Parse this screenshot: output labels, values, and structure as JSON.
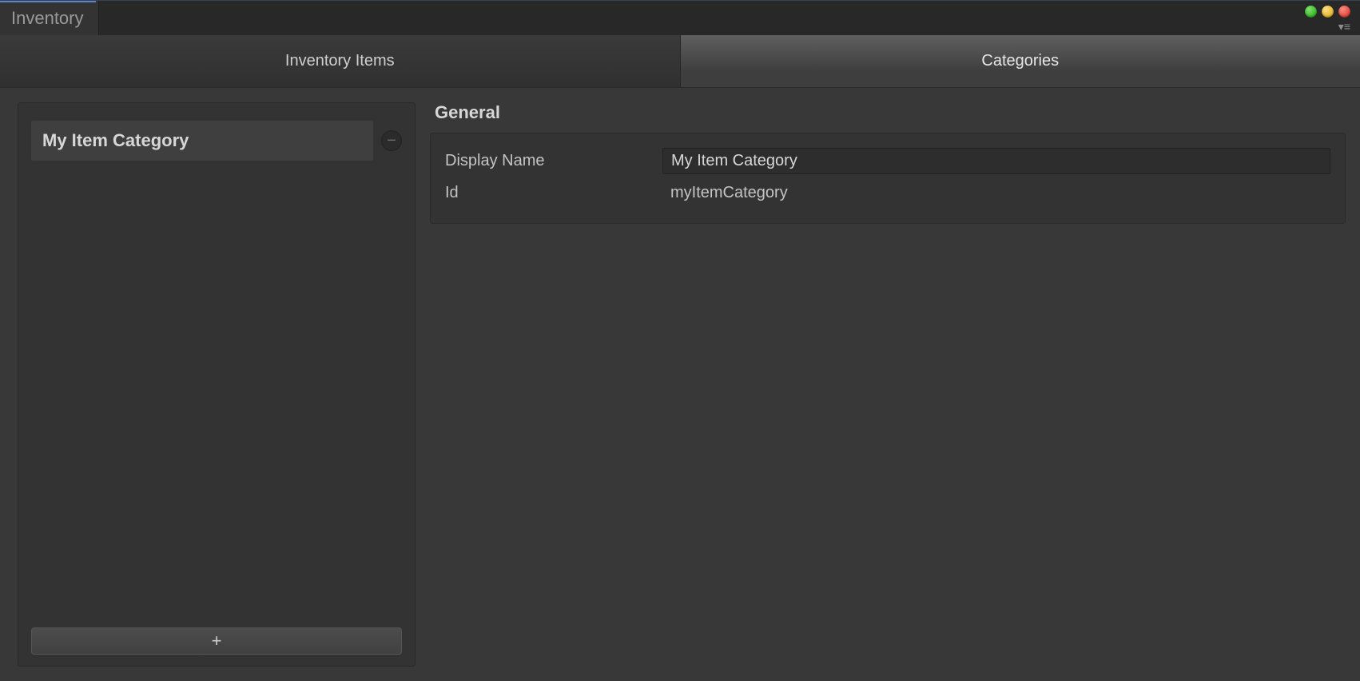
{
  "window": {
    "tab_title": "Inventory"
  },
  "tabs": {
    "inventory_items": "Inventory Items",
    "categories": "Categories",
    "active": "categories"
  },
  "category_list": {
    "items": [
      {
        "label": "My Item Category"
      }
    ],
    "add_label": "+",
    "remove_label": "−"
  },
  "detail": {
    "section_title": "General",
    "fields": {
      "display_name": {
        "label": "Display Name",
        "value": "My Item Category"
      },
      "id": {
        "label": "Id",
        "value": "myItemCategory"
      }
    }
  }
}
